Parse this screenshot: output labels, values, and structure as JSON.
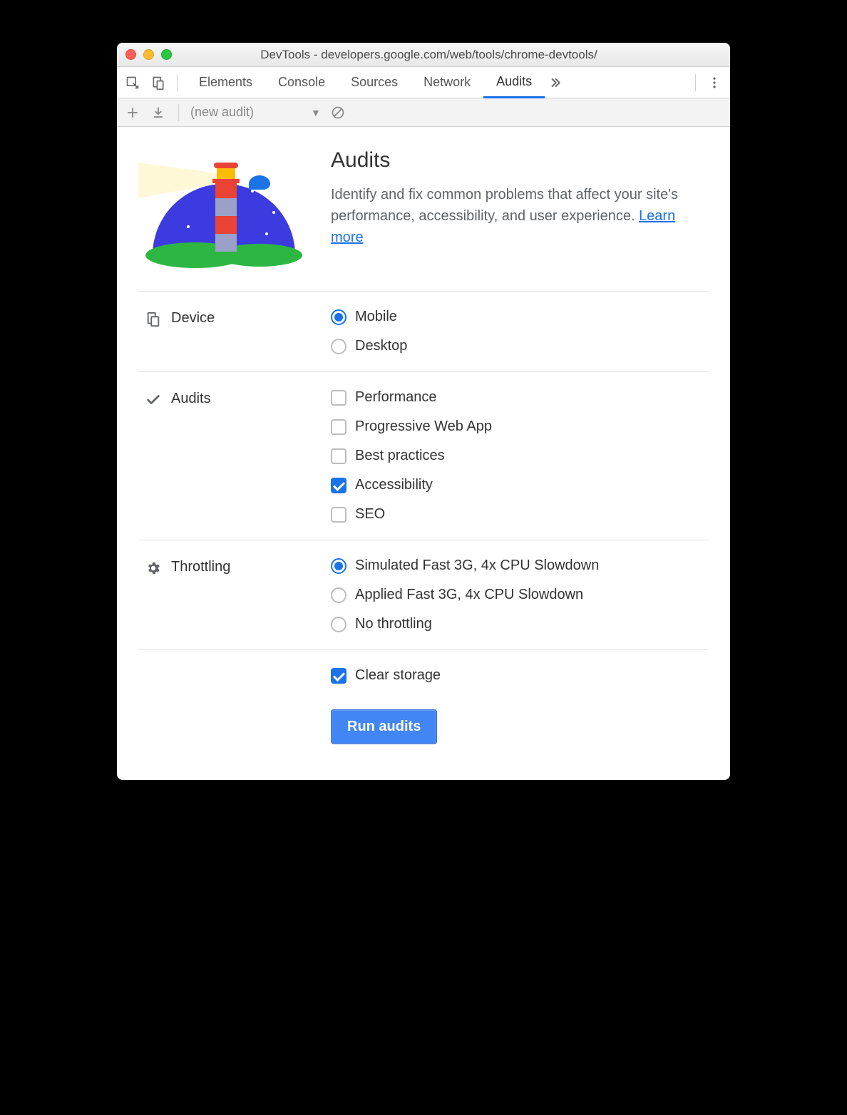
{
  "window": {
    "title": "DevTools - developers.google.com/web/tools/chrome-devtools/"
  },
  "tabs": {
    "items": [
      "Elements",
      "Console",
      "Sources",
      "Network",
      "Audits"
    ],
    "active": "Audits"
  },
  "audit_toolbar": {
    "dropdown_label": "(new audit)"
  },
  "intro": {
    "heading": "Audits",
    "body": "Identify and fix common problems that affect your site's performance, accessibility, and user experience. ",
    "learn_more": "Learn more"
  },
  "sections": {
    "device": {
      "label": "Device",
      "options": [
        {
          "label": "Mobile",
          "checked": true
        },
        {
          "label": "Desktop",
          "checked": false
        }
      ]
    },
    "audits": {
      "label": "Audits",
      "options": [
        {
          "label": "Performance",
          "checked": false
        },
        {
          "label": "Progressive Web App",
          "checked": false
        },
        {
          "label": "Best practices",
          "checked": false
        },
        {
          "label": "Accessibility",
          "checked": true
        },
        {
          "label": "SEO",
          "checked": false
        }
      ]
    },
    "throttling": {
      "label": "Throttling",
      "options": [
        {
          "label": "Simulated Fast 3G, 4x CPU Slowdown",
          "checked": true
        },
        {
          "label": "Applied Fast 3G, 4x CPU Slowdown",
          "checked": false
        },
        {
          "label": "No throttling",
          "checked": false
        }
      ]
    },
    "clear_storage": {
      "label": "Clear storage",
      "checked": true
    }
  },
  "run_button": "Run audits"
}
